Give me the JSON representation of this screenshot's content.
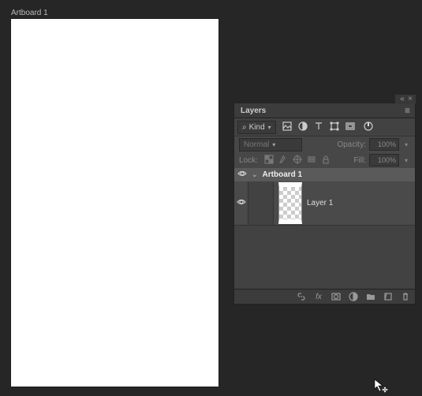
{
  "canvas": {
    "artboard_label": "Artboard 1"
  },
  "layers_panel": {
    "title": "Layers",
    "filter": {
      "mode": "Kind",
      "icons": [
        "image",
        "adjust",
        "type",
        "shape",
        "smart"
      ]
    },
    "blend": {
      "mode": "Normal",
      "opacity_label": "Opacity:",
      "opacity_value": "100%"
    },
    "lock": {
      "label": "Lock:",
      "fill_label": "Fill:",
      "fill_value": "100%"
    },
    "tree": {
      "artboard_name": "Artboard 1",
      "layer1_name": "Layer 1"
    },
    "footer_icons": [
      "link",
      "fx",
      "mask",
      "adj",
      "group",
      "new",
      "trash"
    ]
  }
}
